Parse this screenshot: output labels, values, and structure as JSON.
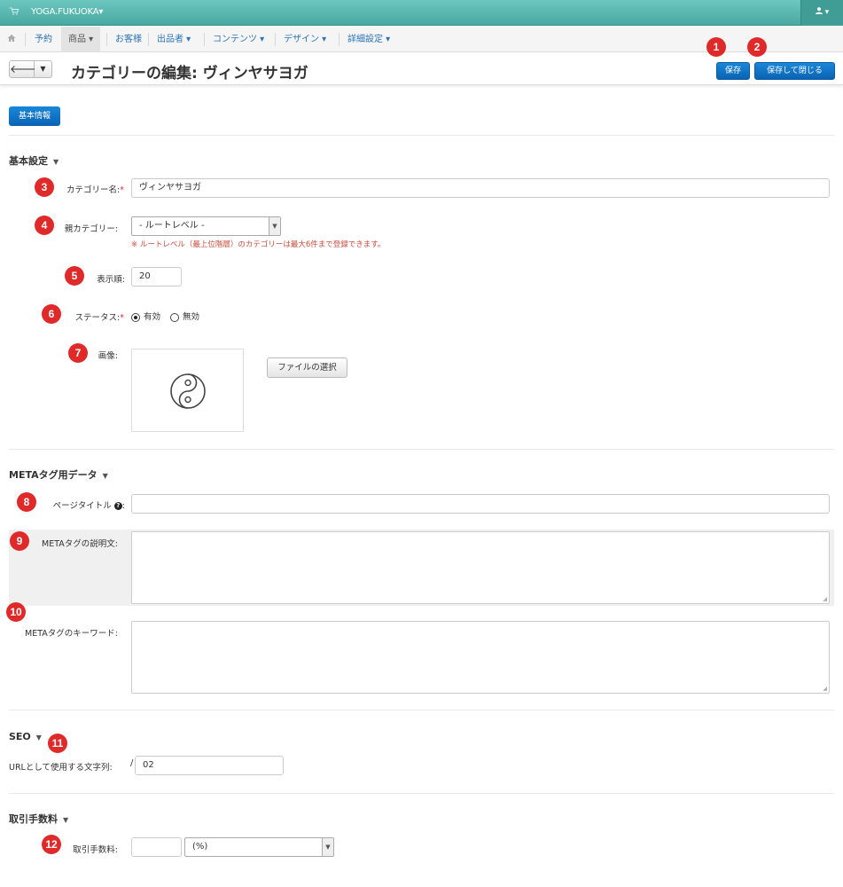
{
  "topbar": {
    "cart_icon": "cart-icon",
    "store_name": "YOGA.FUKUOKA",
    "store_caret": "▾",
    "user_caret": "▾"
  },
  "menu": {
    "home_icon": "home-icon",
    "items": [
      {
        "label": "予約"
      },
      {
        "label": "商品 ▾"
      },
      {
        "label": "お客様"
      },
      {
        "label": "出品者 ▾"
      },
      {
        "label": "コンテンツ ▾"
      },
      {
        "label": "デザイン ▾"
      },
      {
        "label": "詳細設定 ▾"
      }
    ]
  },
  "header": {
    "title": "カテゴリーの編集: ヴィンヤサヨガ",
    "back_symbol": "🡐",
    "save_label": "保存",
    "save_close_label": "保存して閉じる"
  },
  "tabs": {
    "basic_info": "基本情報"
  },
  "sections": {
    "basic": "基本設定",
    "meta": "METAタグ用データ",
    "seo": "SEO",
    "fee": "取引手数料"
  },
  "fields": {
    "category_name_label": "カテゴリー名:",
    "category_name_value": "ヴィンヤサヨガ",
    "parent_label": "親カテゴリー:",
    "parent_value": "- ルートレベル -",
    "parent_note": "※ ルートレベル（最上位階層）のカテゴリーは最大6件まで登録できます。",
    "order_label": "表示順:",
    "order_value": "20",
    "status_label": "ステータス:",
    "status_on": "有効",
    "status_off": "無効",
    "status_selected": "有効",
    "image_label": "画像:",
    "image_icon": "yin-yang-icon",
    "file_button": "ファイルの選択",
    "page_title_label": "ページタイトル",
    "meta_desc_label": "METAタグの説明文:",
    "meta_keywords_label": "METAタグのキーワード:",
    "url_label": "URLとして使用する文字列:",
    "url_prefix": "/",
    "url_value": "02",
    "fee_label": "取引手数料:",
    "fee_value": "",
    "fee_unit": "(%)"
  },
  "markers": [
    "1",
    "2",
    "3",
    "4",
    "5",
    "6",
    "7",
    "8",
    "9",
    "10",
    "11",
    "12"
  ],
  "colors": {
    "accent": "#0b63b3",
    "topbar": "#48a9a1",
    "marker": "#e02a2a",
    "note": "#cc4a3a"
  }
}
